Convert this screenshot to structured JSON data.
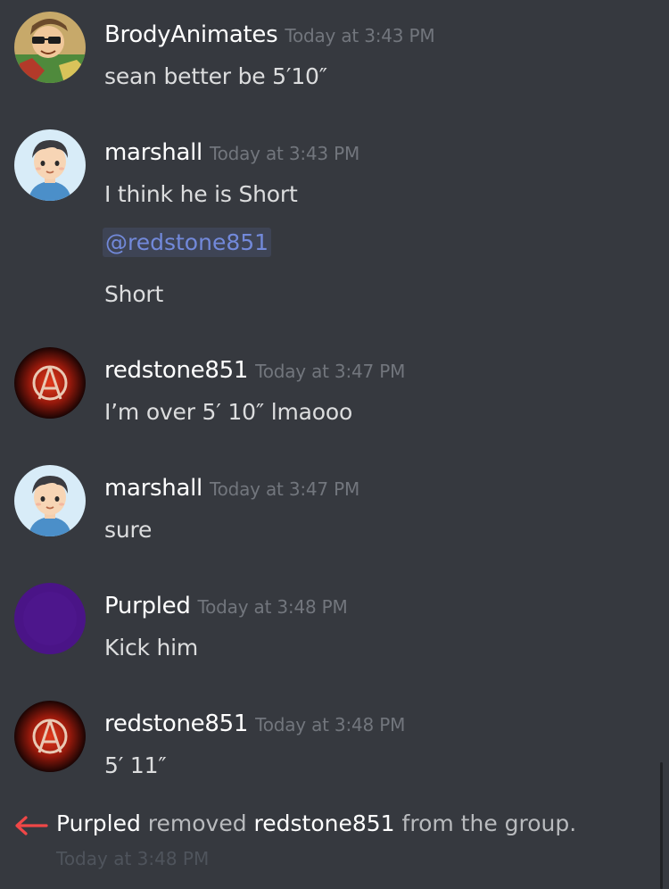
{
  "messages": [
    {
      "username": "BrodyAnimates",
      "timestamp": "Today at 3:43 PM",
      "lines": [
        "sean better be 5′10″"
      ]
    },
    {
      "username": "marshall",
      "timestamp": "Today at 3:43 PM",
      "lines": [
        "I think he is Short"
      ],
      "mention": "@redstone851",
      "after_mention": "Short"
    },
    {
      "username": "redstone851",
      "timestamp": "Today at 3:47 PM",
      "lines": [
        "I’m over 5′ 10″ lmaooo"
      ]
    },
    {
      "username": "marshall",
      "timestamp": "Today at 3:47 PM",
      "lines": [
        "sure"
      ]
    },
    {
      "username": "Purpled",
      "timestamp": "Today at 3:48 PM",
      "lines": [
        "Kick him"
      ]
    },
    {
      "username": "redstone851",
      "timestamp": "Today at 3:48 PM",
      "lines": [
        "5′ 11″"
      ]
    }
  ],
  "system_message": {
    "actor": "Purpled",
    "verb": "removed",
    "target": "redstone851",
    "suffix": "from the group.",
    "timestamp": "Today at 3:48 PM"
  },
  "colors": {
    "background": "#36393f",
    "username": "#ffffff",
    "text": "#dcddde",
    "timestamp": "#72767d",
    "mention": "#7289da",
    "leave_arrow": "#f04747"
  }
}
